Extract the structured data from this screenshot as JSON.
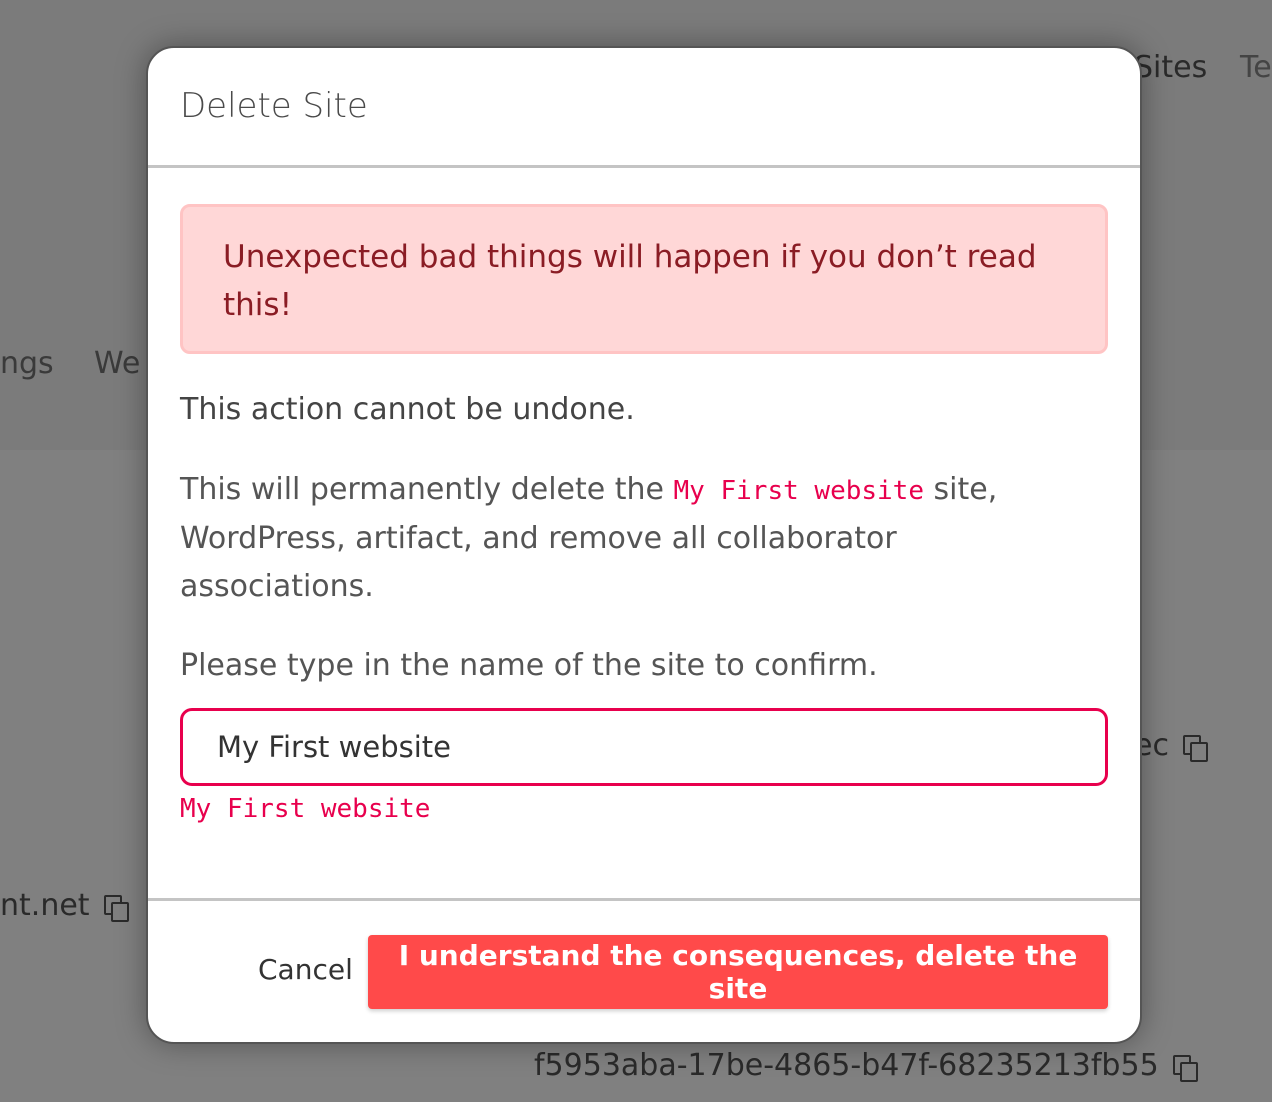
{
  "background": {
    "nav_sites": "Sites",
    "nav_te": "Te",
    "nav_ngs": "ngs",
    "nav_we": "We",
    "domain_partial": "nt.net",
    "id_partial_ec": "ec",
    "site_uuid": "f5953aba-17be-4865-b47f-68235213fb55"
  },
  "modal": {
    "title": "Delete Site",
    "alert": "Unexpected bad things will happen if you don’t read this!",
    "warning": "This action cannot be undone.",
    "desc_before": "This will permanently delete the ",
    "site_name": "My First website",
    "desc_after": " site, WordPress, artifact, and remove all collaborator associations.",
    "confirm_prompt": "Please type in the name of the site to confirm.",
    "input_value": "My First website",
    "expected_name": "My First website",
    "cancel_label": "Cancel",
    "delete_label": "I understand the consequences, delete the site"
  }
}
